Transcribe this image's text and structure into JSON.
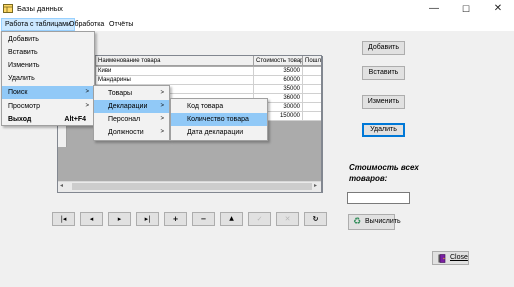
{
  "window": {
    "title": "Базы данных",
    "controls": [
      "—",
      "☐",
      "✕"
    ]
  },
  "menubar": {
    "items": [
      "Работа с таблицами",
      "Обработка",
      "Отчёты"
    ]
  },
  "tables_menu": {
    "items": [
      {
        "label": "Добавить"
      },
      {
        "label": "Вставить"
      },
      {
        "label": "Изменить"
      },
      {
        "label": "Удалить"
      },
      {
        "label": "Поиск",
        "arrow": ">"
      },
      {
        "label": "Просмотр",
        "arrow": ">"
      },
      {
        "label": "Выход",
        "shortcut": "Alt+F4"
      }
    ]
  },
  "search_menu": {
    "items": [
      {
        "label": "Товары",
        "arrow": ">"
      },
      {
        "label": "Декларации",
        "arrow": ">"
      },
      {
        "label": "Персонал",
        "arrow": ">"
      },
      {
        "label": "Должности",
        "arrow": ">"
      }
    ]
  },
  "declarations_menu": {
    "items": [
      {
        "label": "Код товара"
      },
      {
        "label": "Количество товара"
      },
      {
        "label": "Дата декларации"
      }
    ]
  },
  "grid": {
    "columns": [
      "Наименование товара",
      "Стоимость товара",
      "Пошли"
    ],
    "rows": [
      {
        "name": "Киви",
        "cost": "35000"
      },
      {
        "name": "Мандарины",
        "cost": "60000"
      },
      {
        "name": "",
        "cost": "35000"
      },
      {
        "name": "",
        "cost": "36000"
      },
      {
        "name": "",
        "cost": "30000"
      },
      {
        "name": "",
        "cost": "150000"
      }
    ],
    "scroll_left": "◂",
    "scroll_right": "▸"
  },
  "actions": {
    "add": "Добавить",
    "insert": "Вставить",
    "edit": "Изменить",
    "delete": "Удалить",
    "calculate": "Вычислить",
    "close": "Close"
  },
  "total": {
    "label": "Стоимость всех товаров:",
    "value": ""
  },
  "navigator": {
    "first": "|◂",
    "prior": "◂",
    "next": "▸",
    "last": "▸|",
    "insert": "+",
    "delete": "−",
    "edit": "▲",
    "post": "✓",
    "cancel": "✕",
    "refresh": "↻"
  },
  "colors": {
    "menu_highlight": "#91c9f7",
    "focus_border": "#0078d7"
  }
}
